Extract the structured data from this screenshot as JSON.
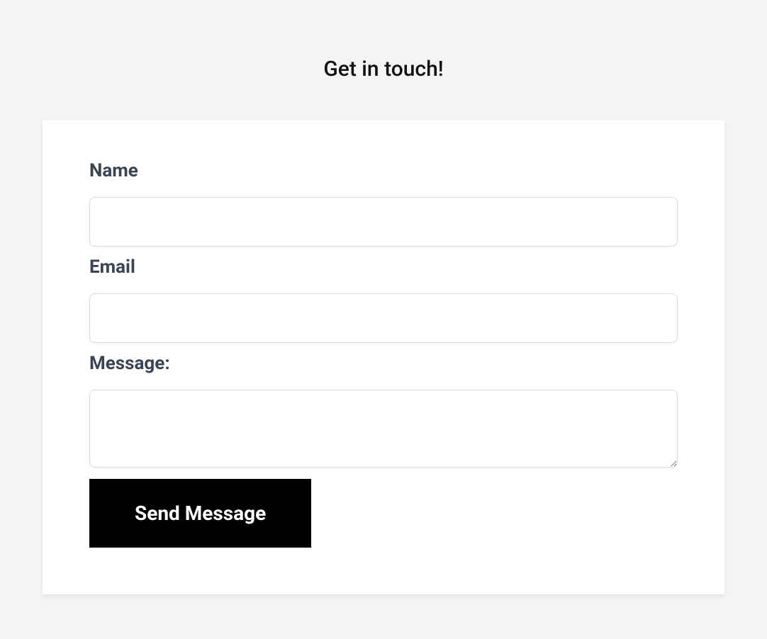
{
  "header": {
    "title": "Get in touch!"
  },
  "form": {
    "name": {
      "label": "Name",
      "value": ""
    },
    "email": {
      "label": "Email",
      "value": ""
    },
    "message": {
      "label": "Message:",
      "value": ""
    },
    "submit_label": "Send Message"
  }
}
